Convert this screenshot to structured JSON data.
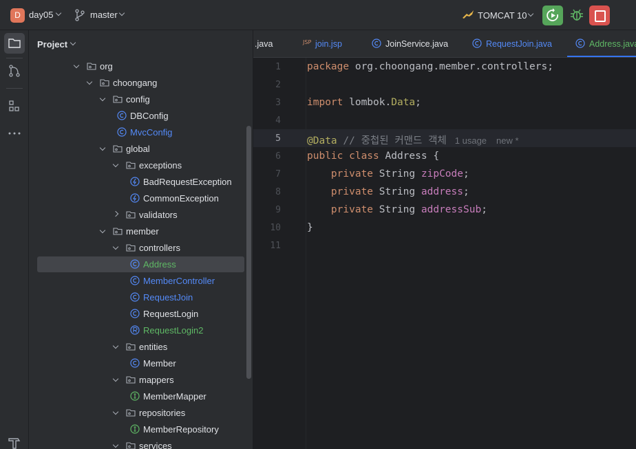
{
  "topbar": {
    "project_initial": "D",
    "project_name": "day05",
    "branch": "master",
    "run_config": "TOMCAT 10"
  },
  "project_panel": {
    "title": "Project",
    "tree": [
      {
        "label": "org",
        "kind": "package",
        "arrow": "open",
        "indent": 0
      },
      {
        "label": "choongang",
        "kind": "package",
        "arrow": "open",
        "indent": 1
      },
      {
        "label": "config",
        "kind": "package",
        "arrow": "open",
        "indent": 2
      },
      {
        "label": "DBConfig",
        "kind": "class",
        "indent": 3,
        "color": "#dfe1e5"
      },
      {
        "label": "MvcConfig",
        "kind": "class",
        "indent": 3,
        "color": "#548af7"
      },
      {
        "label": "global",
        "kind": "package",
        "arrow": "open",
        "indent": 2
      },
      {
        "label": "exceptions",
        "kind": "package",
        "arrow": "open",
        "indent": 3
      },
      {
        "label": "BadRequestException",
        "kind": "exception",
        "indent": 4,
        "color": "#dfe1e5"
      },
      {
        "label": "CommonException",
        "kind": "exception",
        "indent": 4,
        "color": "#dfe1e5"
      },
      {
        "label": "validators",
        "kind": "package",
        "arrow": "closed",
        "indent": 3
      },
      {
        "label": "member",
        "kind": "package",
        "arrow": "open",
        "indent": 2
      },
      {
        "label": "controllers",
        "kind": "package",
        "arrow": "open",
        "indent": 3
      },
      {
        "label": "Address",
        "kind": "class",
        "indent": 4,
        "color": "#5fb865",
        "selected": true
      },
      {
        "label": "MemberController",
        "kind": "class",
        "indent": 4,
        "color": "#548af7"
      },
      {
        "label": "RequestJoin",
        "kind": "class",
        "indent": 4,
        "color": "#548af7"
      },
      {
        "label": "RequestLogin",
        "kind": "class",
        "indent": 4,
        "color": "#dfe1e5"
      },
      {
        "label": "RequestLogin2",
        "kind": "record",
        "indent": 4,
        "color": "#5fb865"
      },
      {
        "label": "entities",
        "kind": "package",
        "arrow": "open",
        "indent": 3
      },
      {
        "label": "Member",
        "kind": "class",
        "indent": 4,
        "color": "#dfe1e5"
      },
      {
        "label": "mappers",
        "kind": "package",
        "arrow": "open",
        "indent": 3
      },
      {
        "label": "MemberMapper",
        "kind": "interface",
        "indent": 4,
        "color": "#dfe1e5"
      },
      {
        "label": "repositories",
        "kind": "package",
        "arrow": "open",
        "indent": 3
      },
      {
        "label": "MemberRepository",
        "kind": "interface",
        "indent": 4,
        "color": "#dfe1e5"
      },
      {
        "label": "services",
        "kind": "package",
        "arrow": "open",
        "indent": 3
      }
    ]
  },
  "tabs": [
    {
      "label": ".java",
      "icon": "none",
      "color": "#dfe1e5"
    },
    {
      "label": "join.jsp",
      "icon": "jsp",
      "color": "#548af7"
    },
    {
      "label": "JoinService.java",
      "icon": "class",
      "color": "#dfe1e5"
    },
    {
      "label": "RequestJoin.java",
      "icon": "class",
      "color": "#548af7"
    },
    {
      "label": "Address.java",
      "icon": "class",
      "color": "#5fb865",
      "active": true
    }
  ],
  "editor": {
    "current_line": 5,
    "line_numbers": [
      "1",
      "2",
      "3",
      "4",
      "5",
      "6",
      "7",
      "8",
      "9",
      "10",
      "11"
    ],
    "lines": {
      "l1_kw": "package",
      "l1_rest": " org.choongang.member.controllers;",
      "l3_kw": "import",
      "l3_pkg": " lombok.",
      "l3_ann": "Data",
      "l3_end": ";",
      "l5_ann": "@Data",
      "l5_cmt": " // 중첩된 커맨드 객체",
      "l5_usage": "1 usage",
      "l5_new": "new *",
      "l6_kw": "public class",
      "l6_rest": " Address {",
      "l7_kw": "    private",
      "l7_type": " String ",
      "l7_field": "zipCode",
      "l8_kw": "    private",
      "l8_type": " String ",
      "l8_field": "address",
      "l9_kw": "    private",
      "l9_type": " String ",
      "l9_field": "addressSub",
      "semi": ";",
      "l10": "}"
    }
  }
}
